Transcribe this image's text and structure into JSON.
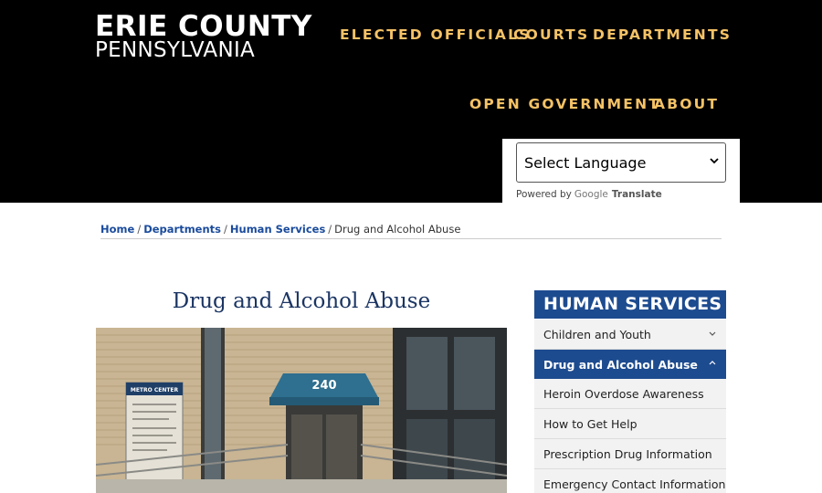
{
  "logo": {
    "line1": "ERIE COUNTY",
    "line2": "PENNSYLVANIA"
  },
  "nav": {
    "elected_officials": "ELECTED OFFICIALS",
    "courts": "COURTS",
    "departments": "DEPARTMENTS",
    "open_government": "OPEN GOVERNMENT",
    "about": "ABOUT"
  },
  "translate": {
    "select_value": "Select Language",
    "powered_by": "Powered by",
    "google": "Google",
    "translate": "Translate"
  },
  "breadcrumb": {
    "home": "Home",
    "departments": "Departments",
    "human_services": "Human Services",
    "current": "Drug and Alcohol Abuse",
    "separator": "/"
  },
  "main": {
    "title": "Drug and Alcohol Abuse",
    "hero": {
      "building_number": "240",
      "sign_title": "METRO CENTER"
    }
  },
  "sidebar": {
    "header": "HUMAN SERVICES",
    "items": [
      {
        "label": "Children and Youth",
        "state": "collapsed"
      },
      {
        "label": "Drug and Alcohol Abuse",
        "state": "expanded"
      },
      {
        "label": "Heroin Overdose Awareness"
      },
      {
        "label": "How to Get Help"
      },
      {
        "label": "Prescription Drug Information"
      },
      {
        "label": "Emergency Contact Information"
      }
    ]
  },
  "colors": {
    "header_bg": "#000000",
    "nav_text": "#f5c266",
    "title_text": "#1b3563",
    "sidebar_accent": "#1d4b8f",
    "link": "#1a4b9c"
  }
}
